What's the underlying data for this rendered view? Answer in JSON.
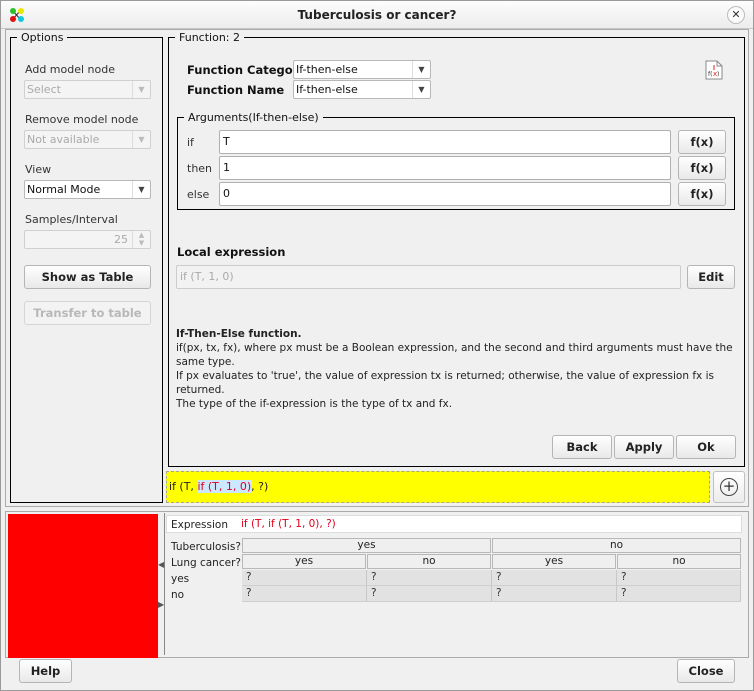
{
  "window": {
    "title": "Tuberculosis or cancer?",
    "app_icon": "network-nodes-icon",
    "close_icon": "close-icon"
  },
  "options": {
    "legend": "Options",
    "add_model_node": {
      "label": "Add model node",
      "value": "Select",
      "enabled": false
    },
    "remove_model_node": {
      "label": "Remove model node",
      "value": "Not available",
      "enabled": false
    },
    "view": {
      "label": "View",
      "value": "Normal Mode",
      "enabled": true
    },
    "samples_interval": {
      "label": "Samples/Interval",
      "value": "25",
      "enabled": false
    },
    "show_as_table": "Show as Table",
    "transfer_to_table": "Transfer to table"
  },
  "function_panel": {
    "legend": "Function: 2",
    "category_label": "Function Category",
    "category_value": "If-then-else",
    "name_label": "Function Name",
    "name_value": "If-then-else",
    "doc_icon": "function-document-icon",
    "arguments": {
      "legend": "Arguments(If-then-else)",
      "rows": [
        {
          "label": "if",
          "value": "T",
          "button": "f(x)"
        },
        {
          "label": "then",
          "value": "1",
          "button": "f(x)"
        },
        {
          "label": "else",
          "value": "0",
          "button": "f(x)"
        }
      ]
    },
    "local_expression_label": "Local expression",
    "local_expression_value": "if (T, 1, 0)",
    "edit_button": "Edit",
    "description": {
      "heading": "If-Then-Else function.",
      "line1": "if(px, tx, fx), where px must be a Boolean expression, and the second and third arguments must have the same type.",
      "line2": "If px evaluates to 'true', the value of expression tx is returned; otherwise, the value of expression fx is returned.",
      "line3": "The type of the if-expression is the type of tx and fx."
    },
    "back_button": "Back",
    "apply_button": "Apply",
    "ok_button": "Ok"
  },
  "expression_bar": {
    "prefix": "if (T, ",
    "highlighted": "if (T, 1, 0)",
    "suffix": ", ?)",
    "background": "#ffff00",
    "add_icon": "plus-circle-icon"
  },
  "table": {
    "color_swatch": "#ff0000",
    "expression_label": "Expression",
    "expression_value": "if (T, if (T, 1, 0), ?)",
    "parent1_label": "Tuberculosis?",
    "parent1_values": [
      "yes",
      "no"
    ],
    "parent2_label": "Lung cancer?",
    "parent2_values": [
      "yes",
      "no",
      "yes",
      "no"
    ],
    "rows": [
      {
        "state": "yes",
        "cells": [
          "?",
          "?",
          "?",
          "?"
        ]
      },
      {
        "state": "no",
        "cells": [
          "?",
          "?",
          "?",
          "?"
        ]
      }
    ]
  },
  "footer": {
    "help_button": "Help",
    "close_button": "Close"
  }
}
